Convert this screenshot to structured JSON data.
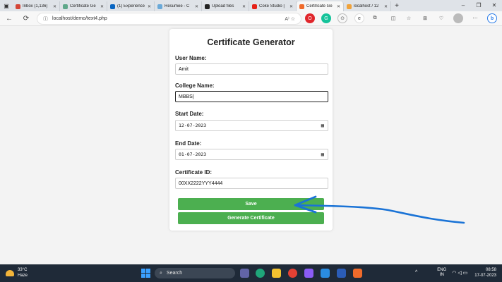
{
  "browser": {
    "tabs": [
      {
        "label": "Inbox (1,136)",
        "color": "#d44638",
        "active": false
      },
      {
        "label": "Certificate Ge",
        "color": "#5fa88a",
        "active": false
      },
      {
        "label": "(1) Experience",
        "color": "#0a66c2",
        "active": false
      },
      {
        "label": "Resumee - C",
        "color": "#6aa9d8",
        "active": false
      },
      {
        "label": "Upload files",
        "color": "#222222",
        "active": false
      },
      {
        "label": "Coke Studio |",
        "color": "#e62117",
        "active": false
      },
      {
        "label": "Certificate Ge",
        "color": "#f06b2b",
        "active": true
      },
      {
        "label": "localhost / 12",
        "color": "#f0a23a",
        "active": false
      }
    ],
    "new_tab": "+",
    "window_controls": {
      "minimize": "–",
      "maximize": "❐",
      "close": "✕"
    },
    "url": "localhost/demo/text4.php",
    "nav": {
      "back": "←",
      "refresh": "⟳"
    }
  },
  "form": {
    "title": "Certificate Generator",
    "fields": {
      "user_name": {
        "label": "User Name:",
        "value": "Amit"
      },
      "college_name": {
        "label": "College Name:",
        "value": "MBBS|"
      },
      "start_date": {
        "label": "Start Date:",
        "value": "12-07-2023"
      },
      "end_date": {
        "label": "End Date:",
        "value": "01-07-2023"
      },
      "certificate_id": {
        "label": "Certificate ID:",
        "value": "00XX2222YYY4444"
      }
    },
    "save_button": "Save",
    "generate_button": "Generate Certificate",
    "button_color": "#4caf50"
  },
  "annotation": {
    "color": "#1a73d6"
  },
  "taskbar": {
    "weather": {
      "temp": "33°C",
      "condition": "Haze"
    },
    "search_label": "Search",
    "tray": {
      "lang_top": "ENG",
      "lang_bottom": "IN",
      "time": "08:58",
      "date": "17-07-2023"
    }
  }
}
